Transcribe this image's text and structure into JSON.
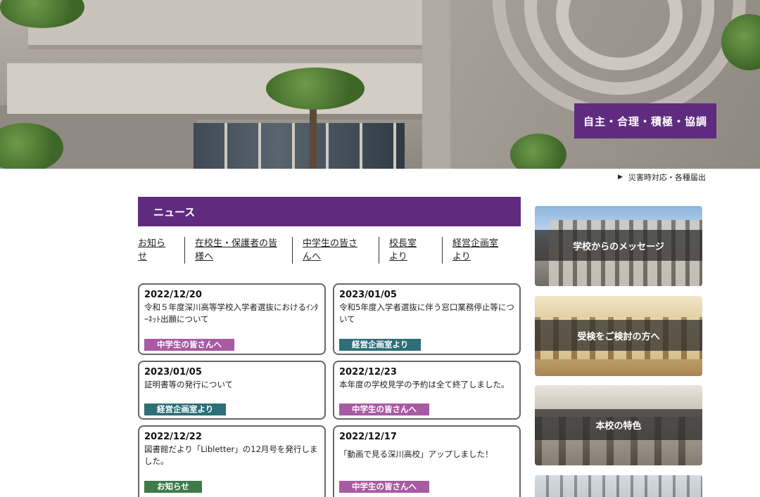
{
  "hero": {
    "motto": "自主・合理・積極・協調"
  },
  "emergency_link": {
    "marker": "▶",
    "label": "災害時対応・各種届出"
  },
  "news": {
    "heading": "ニュース",
    "tabs": [
      {
        "label": "お知らせ"
      },
      {
        "label": "在校生・保護者の皆様へ"
      },
      {
        "label": "中学生の皆さんへ"
      },
      {
        "label": "校長室より"
      },
      {
        "label": "経営企画室より"
      }
    ],
    "items": [
      {
        "date": "2022/12/20",
        "title": "令和５年度深川高等学校入学者選抜におけるｲﾝﾀｰﾈｯﾄ出願について",
        "tag": "中学生の皆さんへ",
        "tag_color": "#a85aa2"
      },
      {
        "date": "2023/01/05",
        "title": "令和5年度入学者選抜に伴う窓口業務停止等について",
        "tag": "経営企画室より",
        "tag_color": "#2e6e78"
      },
      {
        "date": "2023/01/05",
        "title": "証明書等の発行について",
        "tag": "経営企画室より",
        "tag_color": "#2e6e78"
      },
      {
        "date": "2022/12/23",
        "title": "本年度の学校見学の予約は全て終了しました。",
        "tag": "中学生の皆さんへ",
        "tag_color": "#a85aa2"
      },
      {
        "date": "2022/12/22",
        "title": "図書館だより「Libletter」の12月号を発行しました。",
        "tag": "お知らせ",
        "tag_color": "#3e7a4a"
      },
      {
        "date": "2022/12/17",
        "title": "「動画で見る深川高校」アップしました！",
        "tag": "中学生の皆さんへ",
        "tag_color": "#a85aa2"
      }
    ]
  },
  "side_banners": [
    {
      "label": "学校からのメッセージ"
    },
    {
      "label": "受検をご検討の方へ"
    },
    {
      "label": "本校の特色"
    }
  ],
  "colors": {
    "brand_purple": "#5f2b7f",
    "tag_purple": "#a85aa2",
    "tag_teal": "#2e6e78",
    "tag_green": "#3e7a4a"
  }
}
